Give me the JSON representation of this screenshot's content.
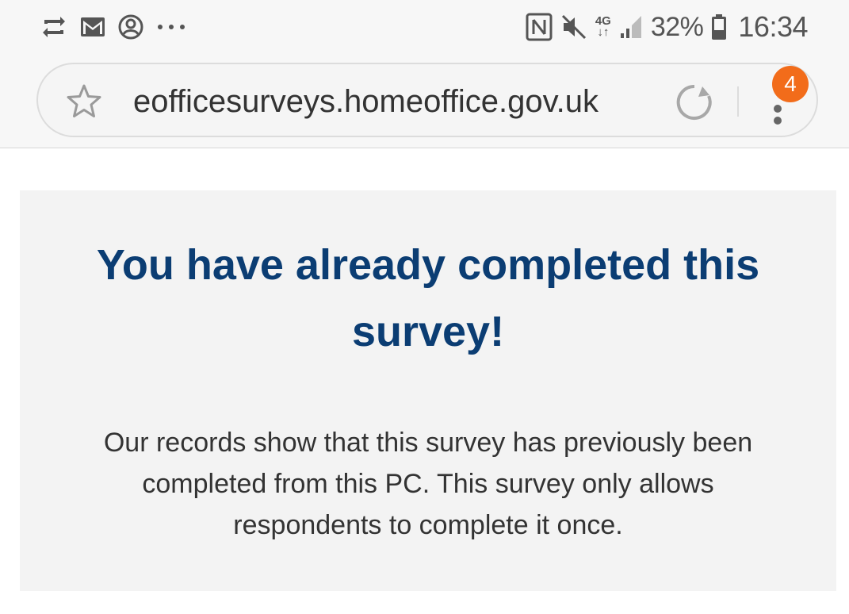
{
  "status_bar": {
    "network": "4G",
    "battery_percent": "32%",
    "time": "16:34",
    "icons_left": [
      "sync-icon",
      "gmail-icon",
      "account-circle-icon",
      "more-dots-icon"
    ],
    "icons_right": [
      "nfc-icon",
      "mute-icon",
      "mobile-data-icon",
      "signal-icon",
      "battery-icon"
    ]
  },
  "browser": {
    "url": "eofficesurveys.homeoffice.gov.uk",
    "notification_count": "4",
    "accent_color": "#f26c1a"
  },
  "page": {
    "heading": "You have already completed this survey!",
    "message": "Our records show that this survey has previously been completed from this PC. This survey only allows respondents to complete it once.",
    "heading_color": "#0b3d73"
  }
}
